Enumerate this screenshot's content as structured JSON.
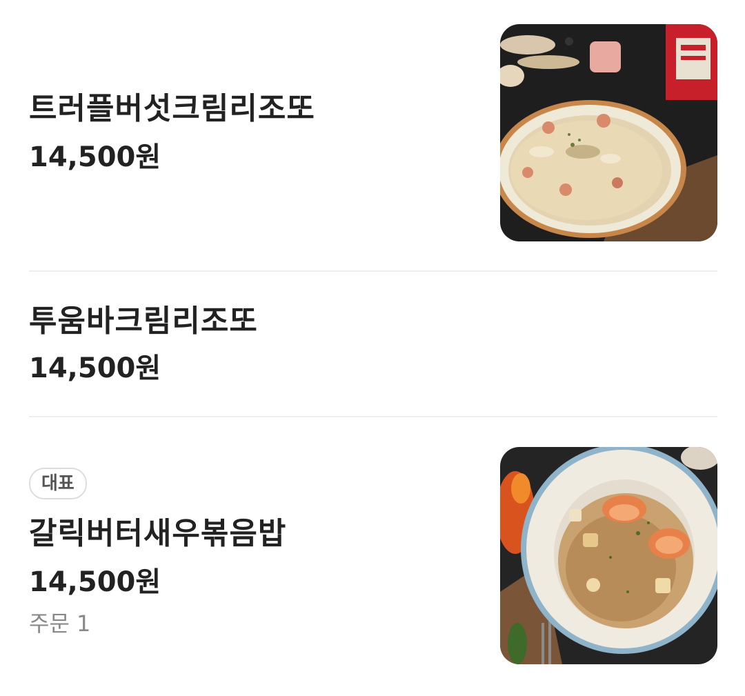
{
  "menu": {
    "items": [
      {
        "name": "트러플버섯크림리조또",
        "price": "14,500원",
        "image": "truffle-mushroom-cream-risotto-photo"
      },
      {
        "name": "투움바크림리조또",
        "price": "14,500원"
      },
      {
        "badge": "대표",
        "name": "갈릭버터새우볶음밥",
        "price": "14,500원",
        "order_count": "주문 1",
        "image": "garlic-butter-shrimp-fried-rice-photo"
      }
    ]
  },
  "colors": {
    "text_primary": "#222222",
    "text_secondary": "#888888",
    "divider": "#eeeeee",
    "badge_border": "#dddddd"
  }
}
